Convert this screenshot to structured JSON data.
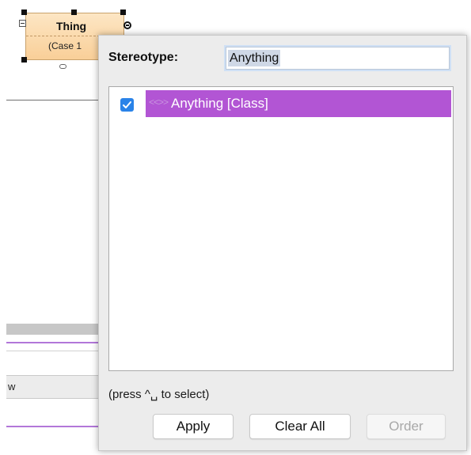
{
  "diagram": {
    "element": {
      "name": "Thing",
      "subtitle": "(Case 1"
    },
    "table_header_partial": "w"
  },
  "dialog": {
    "stereotype_label": "Stereotype:",
    "stereotype_value": "Anything",
    "items": [
      {
        "label": "Anything [Class]",
        "checked": true,
        "icon": "stereotype-icon"
      }
    ],
    "hint": "(press ^␣ to select)",
    "buttons": {
      "apply": "Apply",
      "clear_all": "Clear All",
      "order": "Order"
    }
  },
  "colors": {
    "selection": "#b255d4",
    "checkbox": "#2a83e8",
    "element_fill": "#f9cf98",
    "purple_rule": "#b277d9"
  }
}
